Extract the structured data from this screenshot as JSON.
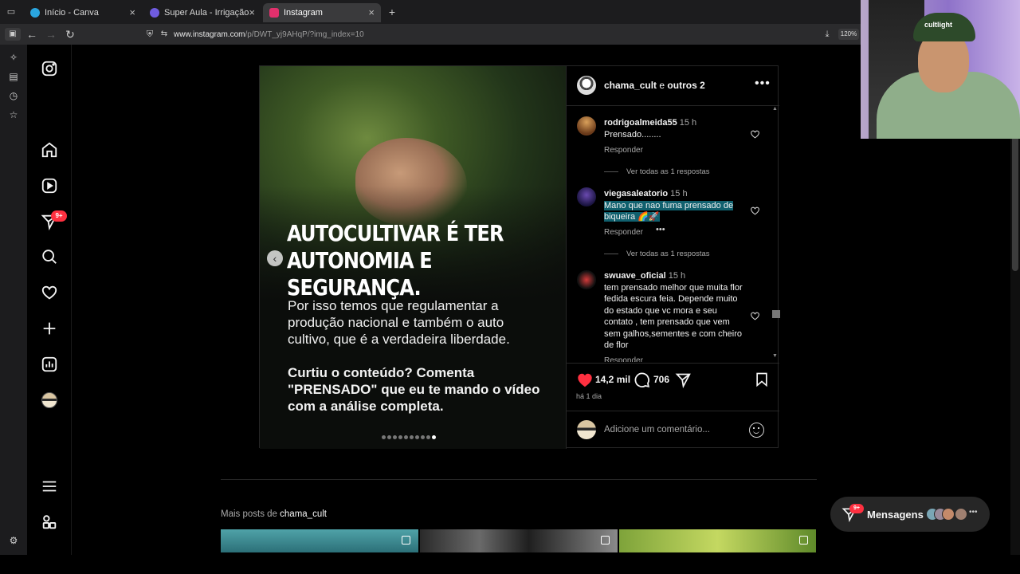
{
  "browser": {
    "tabs": [
      {
        "title": "Início - Canva",
        "active": false,
        "favicon_color": "#2aa6e0"
      },
      {
        "title": "Super Aula - Irrigação de Precisão",
        "active": false,
        "favicon_color": "#6f5ce0"
      },
      {
        "title": "Instagram",
        "active": true,
        "favicon_color": "#e1306c"
      }
    ],
    "url_host": "www.instagram.com",
    "url_path": "/p/DWT_yj9AHqP/?img_index=10",
    "zoom": "120%"
  },
  "post": {
    "author": "chama_cult",
    "coauthors": "outros 2",
    "connector": "e",
    "slide": {
      "headline": "AUTOCULTIVAR É TER AUTONOMIA E SEGURANÇA.",
      "body": "Por isso temos que regulamentar a produção nacional e também o auto cultivo, que é a verdadeira liberdade.",
      "cta": "Curtiu o conteúdo? Comenta \"PRENSADO\" que eu te mando o vídeo com a análise completa.",
      "total_slides": 10,
      "current_slide": 10
    },
    "comments": [
      {
        "user": "rodrigoalmeida55",
        "time": "15 h",
        "text": "Prensado........",
        "reply_label": "Responder",
        "view_replies": "Ver todas as 1 respostas"
      },
      {
        "user": "viegasaleatorio",
        "time": "15 h",
        "text": "Mano que nao fuma prensado de biqueira 🌈🚀",
        "reply_label": "Responder",
        "view_replies": "Ver todas as 1 respostas"
      },
      {
        "user": "swuave_oficial",
        "time": "15 h",
        "text": "tem prensado melhor que muita flor fedida escura feia. Depende muito do estado que vc mora e seu contato , tem prensado que vem sem galhos,sementes e com cheiro de flor",
        "reply_label": "Responder"
      }
    ],
    "likes": "14,2 mil",
    "comments_count": "706",
    "posted_ago": "há 1 dia",
    "add_comment_placeholder": "Adicione um comentário...",
    "more_posts_prefix": "Mais posts de",
    "more_posts_user": "chama_cult"
  },
  "nav": {
    "notification_badge": "9+"
  },
  "messages": {
    "label": "Mensagens",
    "badge": "9+"
  },
  "webcam": {
    "cap_text": "cultlight"
  },
  "colors": {
    "like_red": "#ff3040",
    "highlight": "#10606e"
  }
}
